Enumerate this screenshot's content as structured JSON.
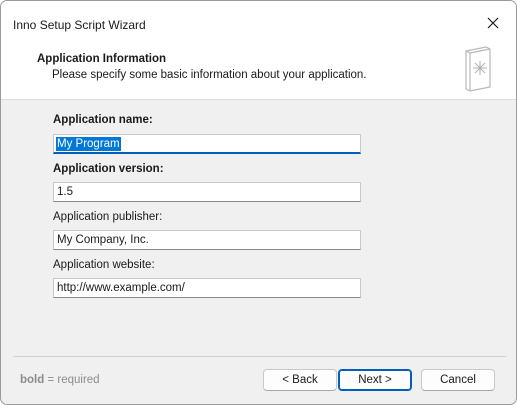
{
  "window": {
    "title": "Inno Setup Script Wizard"
  },
  "header": {
    "title": "Application Information",
    "subtitle": "Please specify some basic information about your application.",
    "icon": "wizard-page-icon"
  },
  "form": {
    "app_name": {
      "label": "Application name:",
      "value": "My Program",
      "required": true
    },
    "app_version": {
      "label": "Application version:",
      "value": "1.5",
      "required": true
    },
    "app_publisher": {
      "label": "Application publisher:",
      "value": "My Company, Inc.",
      "required": false
    },
    "app_website": {
      "label": "Application website:",
      "value": "http://www.example.com/",
      "required": false
    }
  },
  "footer": {
    "hint_bold": "bold",
    "hint_rest": " = required",
    "back_label": "< Back",
    "next_label": "Next >",
    "cancel_label": "Cancel"
  },
  "colors": {
    "accent": "#005fb8",
    "selection": "#0078d7"
  }
}
